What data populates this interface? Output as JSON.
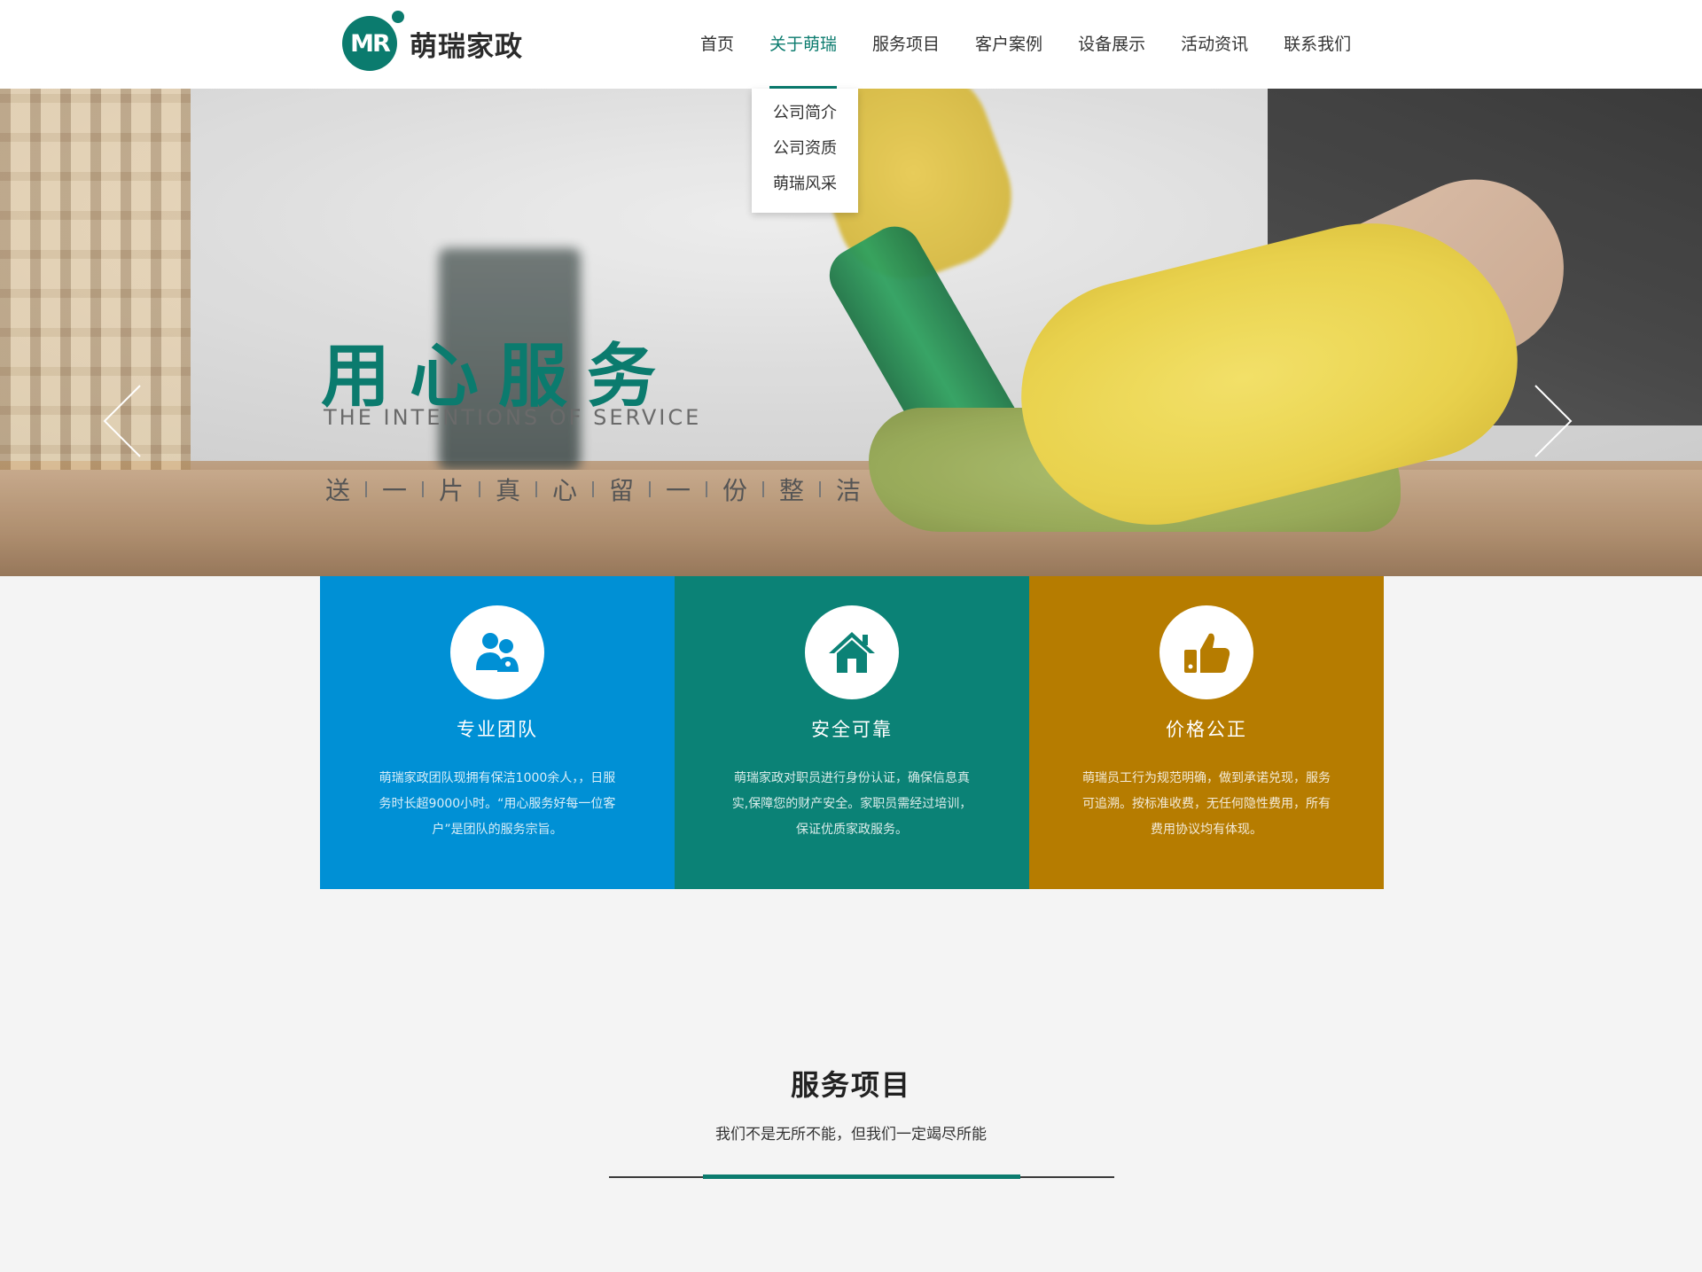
{
  "logo": {
    "mark": "MR",
    "name": "萌瑞家政"
  },
  "nav": {
    "items": [
      "首页",
      "关于萌瑞",
      "服务项目",
      "客户案例",
      "设备展示",
      "活动资讯",
      "联系我们"
    ],
    "active_index": 1
  },
  "dropdown": {
    "items": [
      "公司简介",
      "公司资质",
      "萌瑞风采"
    ]
  },
  "hero": {
    "title": "用心服务",
    "subtitle": "THE INTENTIONS OF SERVICE",
    "slogan": [
      "送",
      "一",
      "片",
      "真",
      "心",
      "留",
      "一",
      "份",
      "整",
      "洁"
    ]
  },
  "features": [
    {
      "title": "专业团队",
      "text": "萌瑞家政团队现拥有保洁1000余人，，日服务时长超9000小时。“用心服务好每一位客户”是团队的服务宗旨。",
      "icon": "team-icon",
      "color": "#0090d5"
    },
    {
      "title": "安全可靠",
      "text": "萌瑞家政对职员进行身份认证，确保信息真实,保障您的财产安全。家职员需经过培训，保证优质家政服务。",
      "icon": "house-icon",
      "color": "#0b8276"
    },
    {
      "title": "价格公正",
      "text": "萌瑞员工行为规范明确，做到承诺兑现，服务可追溯。按标准收费，无任何隐性费用，所有费用协议均有体现。",
      "icon": "thumbs-up-icon",
      "color": "#b67c00"
    }
  ],
  "services": {
    "title": "服务项目",
    "subtitle": "我们不是无所不能，但我们一定竭尽所能"
  },
  "colors": {
    "brand": "#0b7b6e",
    "background": "#f4f4f4"
  }
}
